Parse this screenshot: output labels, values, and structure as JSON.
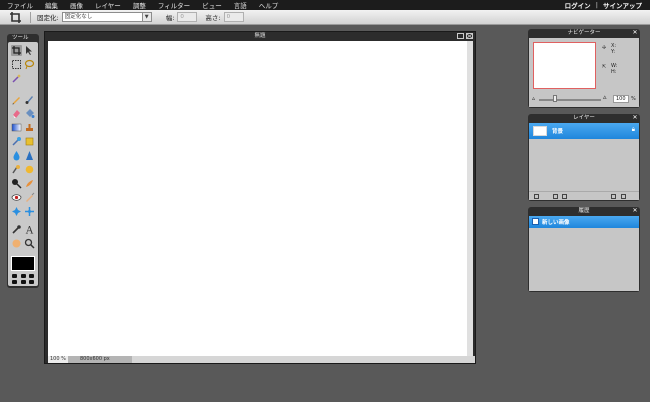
{
  "menubar": {
    "items": [
      "ファイル",
      "編集",
      "画像",
      "レイヤー",
      "調整",
      "フィルター",
      "ビュー",
      "言語",
      "ヘルプ"
    ],
    "login": "ログイン",
    "separator": "|",
    "signup": "サインアップ"
  },
  "optionbar": {
    "fixed_label": "固定化:",
    "fixed_value": "固定化なし",
    "width_label": "幅:",
    "width_value": "0",
    "height_label": "高さ:",
    "height_value": "0"
  },
  "tools": {
    "title": "ツール",
    "foreground_color": "#000000"
  },
  "document": {
    "title": "無題",
    "zoom": "100",
    "zoom_unit": "%",
    "size": "800x600 px"
  },
  "navigator": {
    "title": "ナビゲーター",
    "x_label": "X:",
    "y_label": "Y:",
    "w_label": "W:",
    "h_label": "H:",
    "zoom_value": "100",
    "zoom_unit": "%"
  },
  "layers": {
    "title": "レイヤー",
    "items": [
      {
        "name": "背景",
        "selected": true
      }
    ]
  },
  "history": {
    "title": "履歴",
    "items": [
      {
        "name": "新しい画像",
        "selected": true
      }
    ]
  },
  "colors": {
    "selection": "#2a90e2",
    "canvas": "#ffffff",
    "background": "#595959"
  }
}
